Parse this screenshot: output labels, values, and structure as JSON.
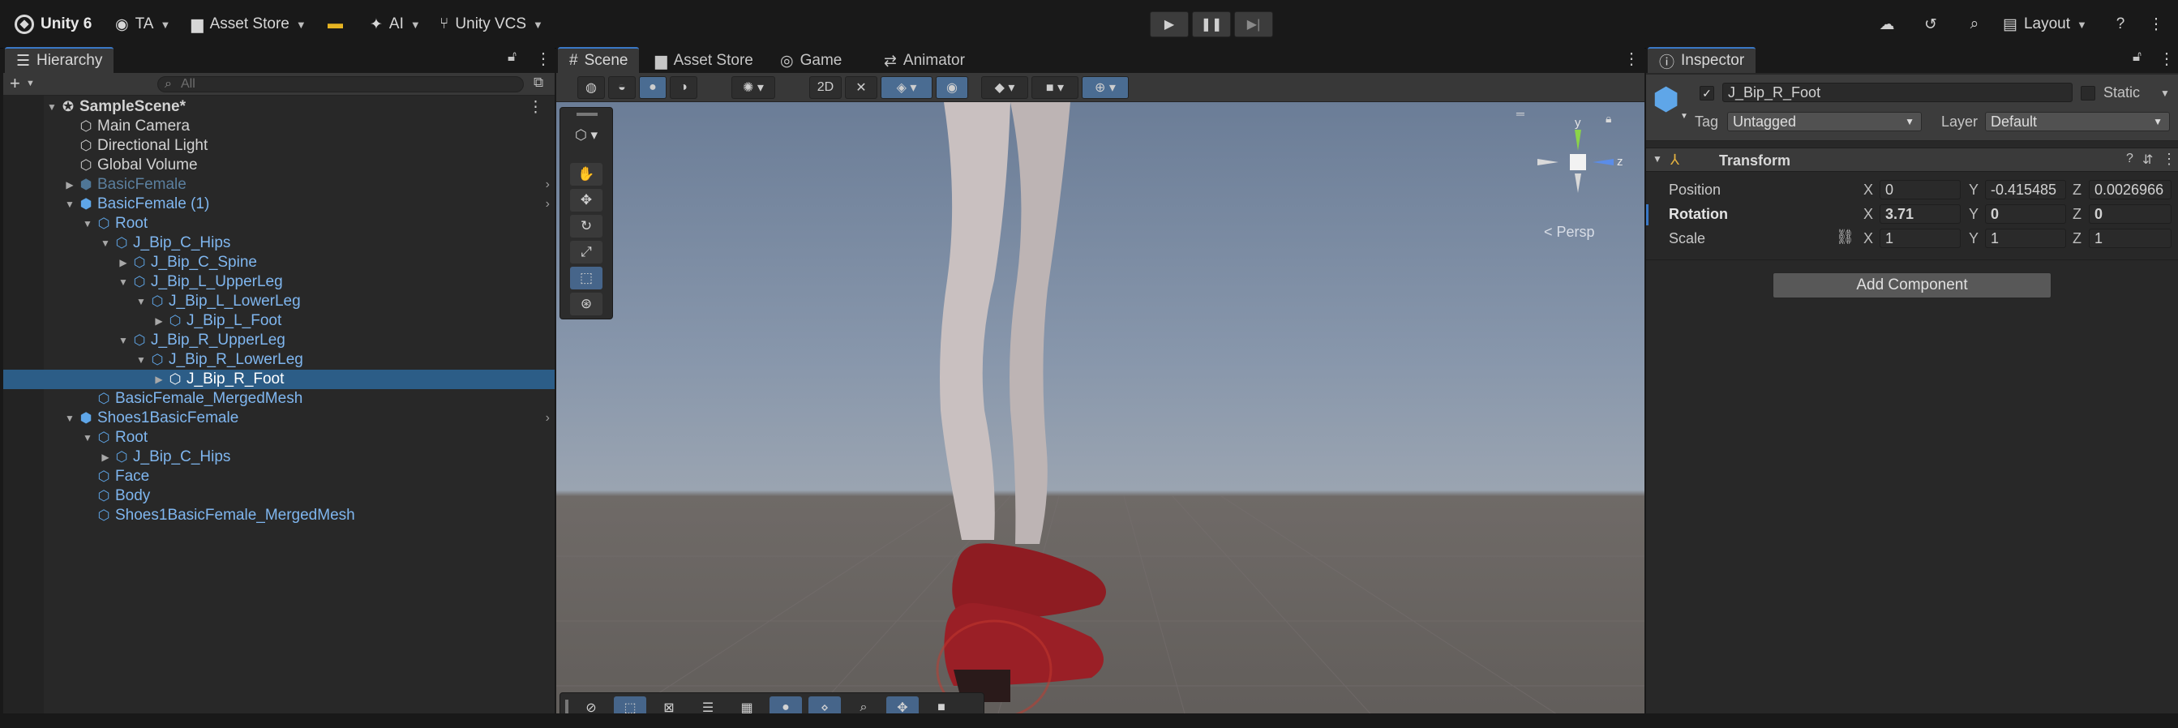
{
  "toolbar": {
    "app_label": "Unity 6",
    "account": "TA",
    "asset_store": "Asset Store",
    "ai": "AI",
    "vcs": "Unity VCS",
    "layout": "Layout",
    "play_icons": [
      "play-icon",
      "pause-icon",
      "step-icon"
    ]
  },
  "hierarchy": {
    "tab": "Hierarchy",
    "search_placeholder": "All",
    "scene_name": "SampleScene*",
    "rows": [
      {
        "label": "Main Camera",
        "type": "object"
      },
      {
        "label": "Directional Light",
        "type": "object"
      },
      {
        "label": "Global Volume",
        "type": "object"
      },
      {
        "label": "BasicFemale",
        "type": "prefab-disabled"
      },
      {
        "label": "BasicFemale (1)",
        "type": "prefab"
      },
      {
        "label": "Root",
        "type": "object"
      },
      {
        "label": "J_Bip_C_Hips",
        "type": "object"
      },
      {
        "label": "J_Bip_C_Spine",
        "type": "object"
      },
      {
        "label": "J_Bip_L_UpperLeg",
        "type": "object"
      },
      {
        "label": "J_Bip_L_LowerLeg",
        "type": "object"
      },
      {
        "label": "J_Bip_L_Foot",
        "type": "object"
      },
      {
        "label": "J_Bip_R_UpperLeg",
        "type": "object"
      },
      {
        "label": "J_Bip_R_LowerLeg",
        "type": "object"
      },
      {
        "label": "J_Bip_R_Foot",
        "type": "object",
        "selected": true
      },
      {
        "label": "BasicFemale_MergedMesh",
        "type": "object"
      },
      {
        "label": "Shoes1BasicFemale",
        "type": "prefab"
      },
      {
        "label": "Root",
        "type": "object"
      },
      {
        "label": "J_Bip_C_Hips",
        "type": "object"
      },
      {
        "label": "Face",
        "type": "object"
      },
      {
        "label": "Body",
        "type": "object"
      },
      {
        "label": "Shoes1BasicFemale_MergedMesh",
        "type": "object"
      }
    ]
  },
  "scene": {
    "tabs": [
      "Scene",
      "Asset Store",
      "Game",
      "Animator"
    ],
    "gizmo_persp": "< Persp",
    "gizmo_axes": {
      "y": "y",
      "z": "z"
    }
  },
  "inspector": {
    "tab": "Inspector",
    "object_name": "J_Bip_R_Foot",
    "static_label": "Static",
    "tag_label": "Tag",
    "tag_value": "Untagged",
    "layer_label": "Layer",
    "layer_value": "Default",
    "component": "Transform",
    "position": {
      "label": "Position",
      "x": "0",
      "y": "-0.415485",
      "z": "0.0026966"
    },
    "rotation": {
      "label": "Rotation",
      "x": "3.71",
      "y": "0",
      "z": "0"
    },
    "scale": {
      "label": "Scale",
      "x": "1",
      "y": "1",
      "z": "1"
    },
    "axis_x": "X",
    "axis_y": "Y",
    "axis_z": "Z",
    "add_component": "Add Component"
  },
  "colors": {
    "selection": "#2c5d87",
    "prefab_text": "#7fb6ef",
    "accent": "#3a78c6"
  }
}
